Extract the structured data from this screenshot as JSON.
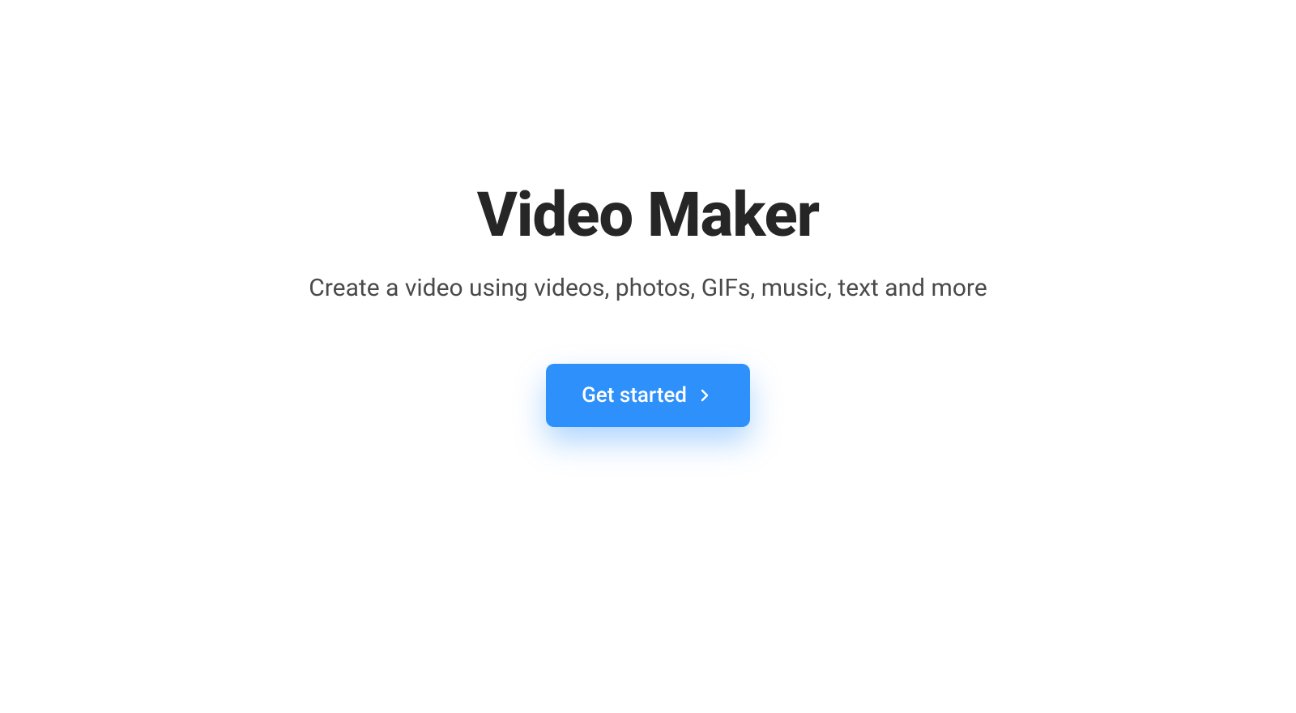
{
  "hero": {
    "title": "Video Maker",
    "subtitle": "Create a video using videos, photos, GIFs, music, text and more"
  },
  "cta": {
    "label": "Get started"
  }
}
